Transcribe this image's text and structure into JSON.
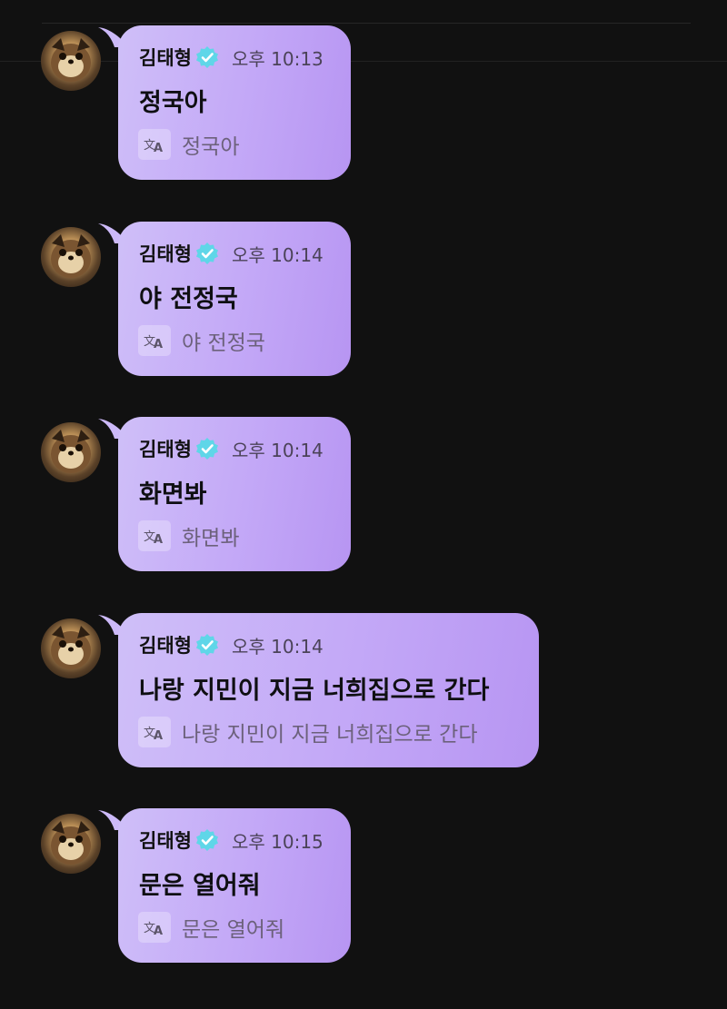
{
  "messages": [
    {
      "sender": "김태형",
      "time": "오후 10:13",
      "text": "정국아",
      "translation": "정국아"
    },
    {
      "sender": "김태형",
      "time": "오후 10:14",
      "text": "야 전정국",
      "translation": "야 전정국"
    },
    {
      "sender": "김태형",
      "time": "오후 10:14",
      "text": "화면봐",
      "translation": "화면봐"
    },
    {
      "sender": "김태형",
      "time": "오후 10:14",
      "text": "나랑 지민이 지금 너희집으로 간다",
      "translation": "나랑 지민이 지금 너희집으로 간다"
    },
    {
      "sender": "김태형",
      "time": "오후 10:15",
      "text": "문은 열어줘",
      "translation": "문은 열어줘"
    }
  ],
  "icons": {
    "verified": "verified-badge-icon",
    "translate": "translate-icon"
  },
  "colors": {
    "background": "#111111",
    "bubble_start": "#cfbff8",
    "bubble_end": "#b795f2",
    "verified": "#5fd6e8"
  }
}
